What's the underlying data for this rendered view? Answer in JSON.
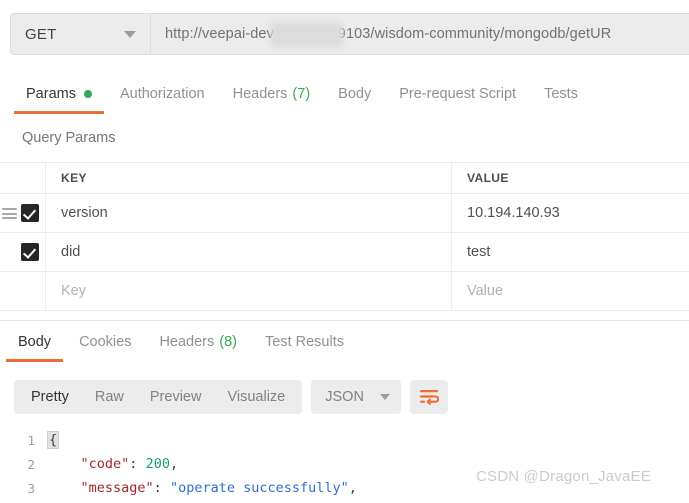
{
  "request": {
    "method": "GET",
    "url": "http://veepai-dev            .eye4.cn:9103/wisdom-community/mongodb/getUR",
    "url_prefix": "http://veepai-dev",
    "url_suffix": ".eye4.cn:9103/wisdom-community/mongodb/getUR",
    "method_caret": "chevron-down-icon",
    "tabs": [
      {
        "label": "Params",
        "count": "",
        "dot": true,
        "active": true
      },
      {
        "label": "Authorization",
        "count": "",
        "dot": false,
        "active": false
      },
      {
        "label": "Headers",
        "count": "(7)",
        "dot": false,
        "active": false
      },
      {
        "label": "Body",
        "count": "",
        "dot": false,
        "active": false
      },
      {
        "label": "Pre-request Script",
        "count": "",
        "dot": false,
        "active": false
      },
      {
        "label": "Tests",
        "count": "",
        "dot": false,
        "active": false
      }
    ]
  },
  "query_params": {
    "section_title": "Query Params",
    "columns": {
      "key": "KEY",
      "value": "VALUE"
    },
    "rows": [
      {
        "checked": true,
        "key": "version",
        "value": "10.194.140.93",
        "draggable": true,
        "placeholder_row": false
      },
      {
        "checked": true,
        "key": "did",
        "value": "test",
        "draggable": false,
        "placeholder_row": false
      },
      {
        "checked": false,
        "key": "Key",
        "value": "Value",
        "draggable": false,
        "placeholder_row": true
      }
    ]
  },
  "response": {
    "tabs": [
      {
        "label": "Body",
        "count": "",
        "active": true
      },
      {
        "label": "Cookies",
        "count": "",
        "active": false
      },
      {
        "label": "Headers",
        "count": "(8)",
        "active": false
      },
      {
        "label": "Test Results",
        "count": "",
        "active": false
      }
    ],
    "view_modes": [
      {
        "label": "Pretty",
        "active": true
      },
      {
        "label": "Raw",
        "active": false
      },
      {
        "label": "Preview",
        "active": false
      },
      {
        "label": "Visualize",
        "active": false
      }
    ],
    "format": "JSON",
    "format_caret": "chevron-down-icon",
    "wrap_button": "word-wrap-icon",
    "body_lines": [
      {
        "number": "1",
        "brace": "{"
      },
      {
        "number": "2",
        "indent": "    ",
        "key": "\"code\"",
        "colon": ": ",
        "number_value": "200",
        "trailing": ","
      },
      {
        "number": "3",
        "indent": "    ",
        "key": "\"message\"",
        "colon": ": ",
        "string_value": "\"operate successfully\"",
        "trailing": ","
      }
    ]
  },
  "watermark": "CSDN @Dragon_JavaEE",
  "colors": {
    "accent": "#ef6c33",
    "green": "#3ba94e",
    "checkbox": "#242628",
    "field_bg": "#ececed"
  }
}
